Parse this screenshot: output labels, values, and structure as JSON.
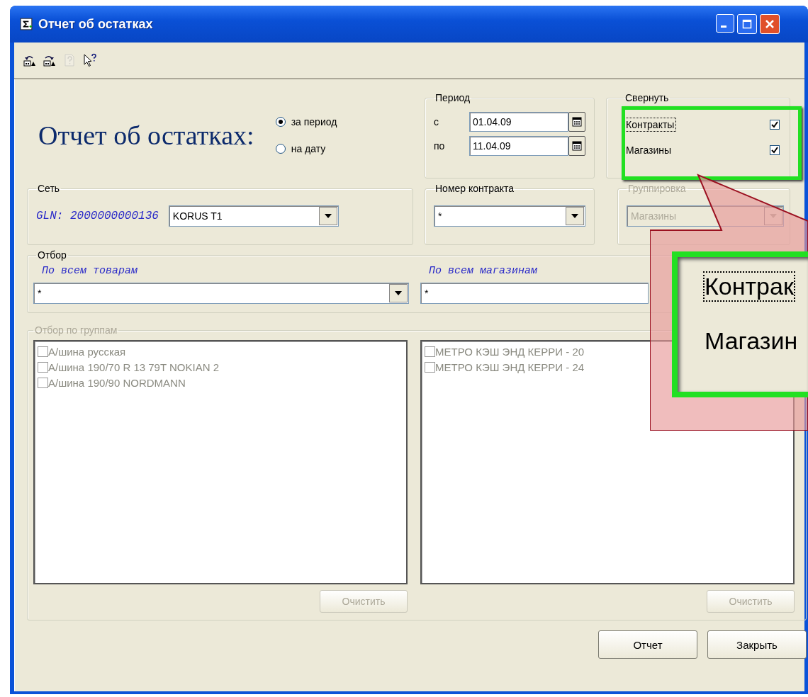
{
  "window": {
    "title": "Отчет об остатках"
  },
  "toolbar": [
    {
      "kind": "undo",
      "disabled": false
    },
    {
      "kind": "redo",
      "disabled": false
    },
    {
      "kind": "help",
      "disabled": true
    },
    {
      "kind": "pointer-help",
      "disabled": false
    }
  ],
  "heading": "Отчет об остатках:",
  "mode_radios": [
    {
      "label": "за период",
      "selected": true
    },
    {
      "label": "на дату",
      "selected": false
    }
  ],
  "period": {
    "title": "Период",
    "from_label": "с",
    "from_value": "01.04.09",
    "to_label": "по",
    "to_value": "11.04.09"
  },
  "collapse": {
    "title": "Свернуть",
    "options": [
      {
        "label": "Контракты",
        "checked": true,
        "focused": true
      },
      {
        "label": "Магазины",
        "checked": true,
        "focused": false
      }
    ]
  },
  "network": {
    "title": "Сеть",
    "gln": "GLN: 2000000000136",
    "value": "KORUS T1"
  },
  "contract": {
    "title": "Номер контракта",
    "value": "*"
  },
  "grouping": {
    "title": "Группировка",
    "value": "Магазины",
    "disabled": true
  },
  "filter": {
    "title": "Отбор",
    "goods_caption": "По всем товарам",
    "goods_value": "*",
    "shops_caption": "По всем магазинам",
    "shops_value": "*"
  },
  "groups": {
    "title": "Отбор по группам",
    "disabled": true,
    "lists": [
      {
        "items": [
          {
            "label": "А/шина русская",
            "checked": false
          },
          {
            "label": "А/шина 190/70 R 13 79T NOKIAN 2",
            "checked": false
          },
          {
            "label": "А/шина 190/90 NORDMANN",
            "checked": false
          }
        ],
        "clear_button": "Очистить"
      },
      {
        "items": [
          {
            "label": "МЕТРО КЭШ ЭНД КЕРРИ - 20",
            "checked": false
          },
          {
            "label": "МЕТРО КЭШ ЭНД КЕРРИ - 24",
            "checked": false
          }
        ],
        "clear_button": "Очистить"
      }
    ]
  },
  "buttons": [
    "Отчет",
    "Закрыть"
  ],
  "callout": {
    "lines": [
      {
        "label": "Контрак",
        "focused": true
      },
      {
        "label": "Магазин",
        "focused": false
      }
    ]
  }
}
